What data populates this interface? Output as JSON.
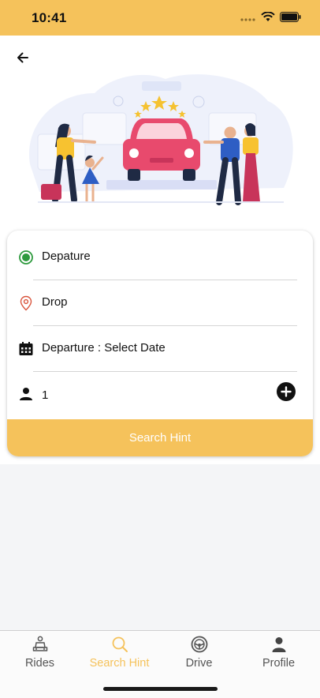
{
  "status": {
    "time": "10:41"
  },
  "form": {
    "departure_label": "Depature",
    "drop_label": "Drop",
    "date_label": "Departure : Select Date",
    "passengers": "1",
    "search_button": "Search Hint"
  },
  "tabs": [
    {
      "label": "Rides",
      "icon": "car-seat-icon"
    },
    {
      "label": "Search Hint",
      "icon": "search-icon"
    },
    {
      "label": "Drive",
      "icon": "steering-wheel-icon"
    },
    {
      "label": "Profile",
      "icon": "person-icon"
    }
  ],
  "colors": {
    "accent": "#f5c25b",
    "car": "#e84a6d",
    "pin": "#d9533b",
    "origin": "#2e9a3e"
  }
}
